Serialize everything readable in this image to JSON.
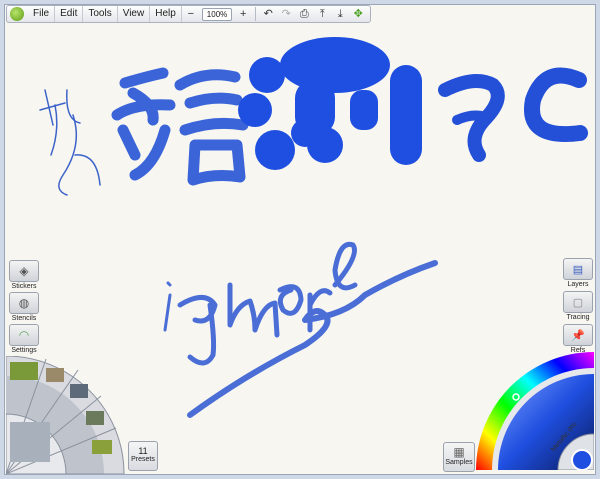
{
  "menu": {
    "items": [
      "File",
      "Edit",
      "Tools",
      "View",
      "Help"
    ],
    "zoom_minus": "−",
    "zoom_value": "100%",
    "zoom_plus": "+"
  },
  "left_panel": {
    "stickers": "Stickers",
    "stencils": "Stencils",
    "settings": "Settings"
  },
  "right_panel": {
    "layers": "Layers",
    "tracing": "Tracing",
    "refs": "Refs"
  },
  "presets": {
    "count": "11",
    "label": "Presets"
  },
  "samples": {
    "label": "Samples"
  },
  "color_picker": {
    "metallic_label": "Metallic 0%"
  },
  "canvas_ink": "#2b55d9"
}
